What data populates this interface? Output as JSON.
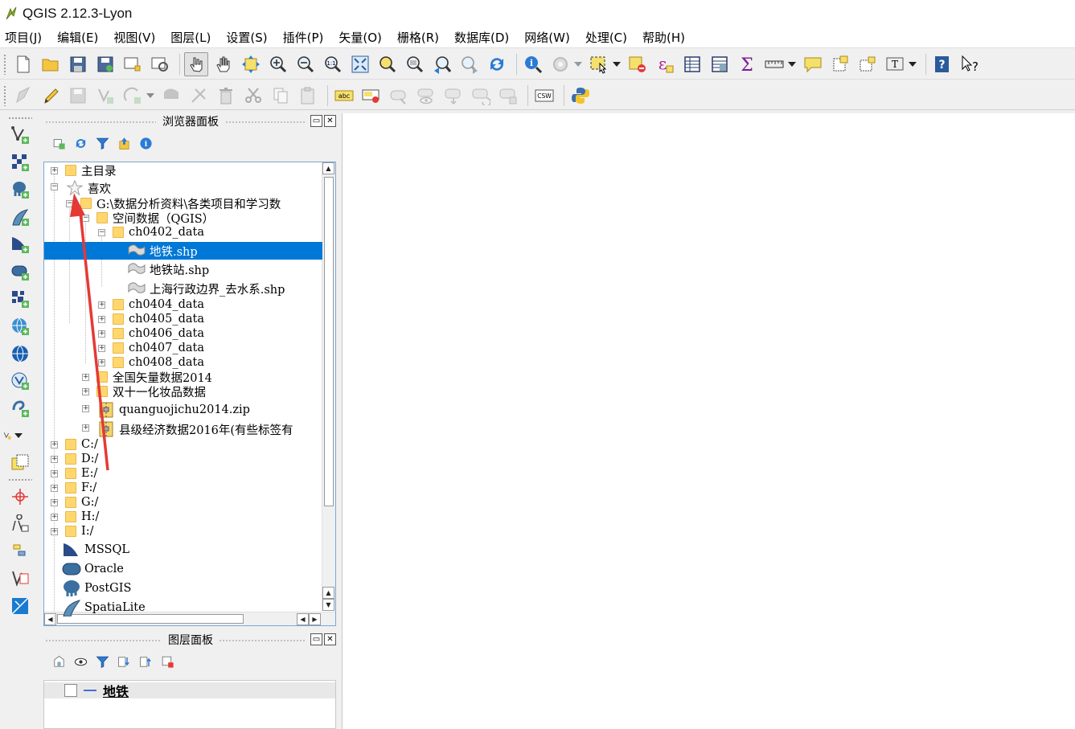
{
  "window": {
    "title": "QGIS 2.12.3-Lyon"
  },
  "menu": [
    "项目(J)",
    "编辑(E)",
    "视图(V)",
    "图层(L)",
    "设置(S)",
    "插件(P)",
    "矢量(O)",
    "栅格(R)",
    "数据库(D)",
    "网络(W)",
    "处理(C)",
    "帮助(H)"
  ],
  "toolbar": {
    "zoom_one_label": "1:1",
    "csw_label": "CSW",
    "label_tool_text": "abc",
    "text_annotation_label": "T",
    "help_label": "?",
    "whats_this_label": "?",
    "epsilon_label": "ε",
    "sigma_label": "Σ"
  },
  "browser_panel": {
    "title": "浏览器面板",
    "tree": [
      {
        "label": "主目录",
        "icon": "folder-icon"
      },
      {
        "label": "喜欢",
        "icon": "star-icon"
      },
      {
        "label": "G:\\数据分析资料\\各类项目和学习数",
        "icon": "folder-icon"
      },
      {
        "label": "空间数据（QGIS）",
        "icon": "folder-icon"
      },
      {
        "label": "ch0402_data",
        "icon": "folder-icon"
      },
      {
        "label": "地铁.shp",
        "icon": "line-layer-icon",
        "selected": true
      },
      {
        "label": "地铁站.shp",
        "icon": "line-layer-icon"
      },
      {
        "label": "上海行政边界_去水系.shp",
        "icon": "line-layer-icon"
      },
      {
        "label": "ch0404_data",
        "icon": "folder-icon"
      },
      {
        "label": "ch0405_data",
        "icon": "folder-icon"
      },
      {
        "label": "ch0406_data",
        "icon": "folder-icon"
      },
      {
        "label": "ch0407_data",
        "icon": "folder-icon"
      },
      {
        "label": "ch0408_data",
        "icon": "folder-icon"
      },
      {
        "label": "全国矢量数据2014",
        "icon": "folder-icon"
      },
      {
        "label": "双十一化妆品数据",
        "icon": "folder-icon"
      },
      {
        "label": "quanguojichu2014.zip",
        "icon": "zip-icon"
      },
      {
        "label": "县级经济数据2016年(有些标签有",
        "icon": "zip-icon"
      },
      {
        "label": "C:/",
        "icon": "folder-icon"
      },
      {
        "label": "D:/",
        "icon": "folder-icon"
      },
      {
        "label": "E:/",
        "icon": "folder-icon"
      },
      {
        "label": "F:/",
        "icon": "folder-icon"
      },
      {
        "label": "G:/",
        "icon": "folder-icon"
      },
      {
        "label": "H:/",
        "icon": "folder-icon"
      },
      {
        "label": "I:/",
        "icon": "folder-icon"
      },
      {
        "label": "MSSQL",
        "icon": "mssql-icon"
      },
      {
        "label": "Oracle",
        "icon": "oracle-icon"
      },
      {
        "label": "PostGIS",
        "icon": "postgis-icon"
      },
      {
        "label": "SpatiaLite",
        "icon": "spatialite-icon"
      }
    ]
  },
  "layers_panel": {
    "title": "图层面板",
    "layers": [
      {
        "name": "地铁",
        "visible": false
      }
    ]
  },
  "colors": {
    "selection": "#0078d7",
    "annotation_arrow": "#e53935",
    "folder": "#ffd76e"
  }
}
